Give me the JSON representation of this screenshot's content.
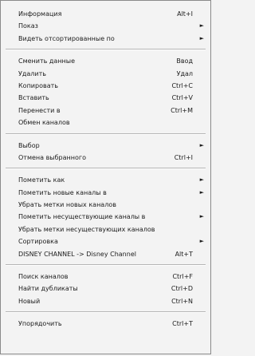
{
  "menu": {
    "groups": [
      [
        {
          "label": "Информация",
          "shortcut": "Alt+I",
          "submenu": false
        },
        {
          "label": "Показ",
          "shortcut": "",
          "submenu": true
        },
        {
          "label": "Видеть отсортированные по",
          "shortcut": "",
          "submenu": true
        }
      ],
      [
        {
          "label": "Сменить данные",
          "shortcut": "Ввод",
          "submenu": false
        },
        {
          "label": "Удалить",
          "shortcut": "Удал",
          "submenu": false
        },
        {
          "label": "Копировать",
          "shortcut": "Ctrl+C",
          "submenu": false
        },
        {
          "label": "Вставить",
          "shortcut": "Ctrl+V",
          "submenu": false
        },
        {
          "label": "Перенести в",
          "shortcut": "Ctrl+M",
          "submenu": false
        },
        {
          "label": "Обмен каналов",
          "shortcut": "",
          "submenu": false
        }
      ],
      [
        {
          "label": "Выбор",
          "shortcut": "",
          "submenu": true
        },
        {
          "label": "Отмена выбранного",
          "shortcut": "Ctrl+I",
          "submenu": false
        }
      ],
      [
        {
          "label": "Пометить как",
          "shortcut": "",
          "submenu": true
        },
        {
          "label": "Пометить новые каналы в",
          "shortcut": "",
          "submenu": true
        },
        {
          "label": "Убрать метки новых каналов",
          "shortcut": "",
          "submenu": false
        },
        {
          "label": "Пометить несуществующие каналы в",
          "shortcut": "",
          "submenu": true
        },
        {
          "label": "Убрать метки несуществующих каналов",
          "shortcut": "",
          "submenu": false
        },
        {
          "label": "Сортировка",
          "shortcut": "",
          "submenu": true
        },
        {
          "label": "DISNEY CHANNEL -> Disney Channel",
          "shortcut": "Alt+T",
          "submenu": false
        }
      ],
      [
        {
          "label": "Поиск каналов",
          "shortcut": "Ctrl+F",
          "submenu": false
        },
        {
          "label": "Найти дубликаты",
          "shortcut": "Ctrl+D",
          "submenu": false
        },
        {
          "label": "Новый",
          "shortcut": "Ctrl+N",
          "submenu": false
        }
      ],
      [
        {
          "label": "Упорядочить",
          "shortcut": "Ctrl+T",
          "submenu": false
        }
      ]
    ],
    "arrow_glyph": "►"
  }
}
